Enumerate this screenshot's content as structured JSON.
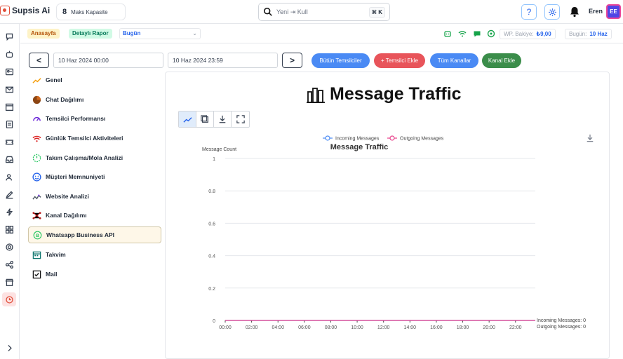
{
  "app": {
    "name": "Supsis Ai"
  },
  "capacity": {
    "value": "8",
    "label": "Maks Kapasite"
  },
  "search": {
    "value": "Yeni ⇥ Kull",
    "shortcut": "⌘ K"
  },
  "user": {
    "name": "Eren",
    "initials": "EE"
  },
  "subbar": {
    "crumb_home": "Anasayfa",
    "crumb_report": "Detaylı Rapor",
    "date_range": "Bugün",
    "wp_balance_label": "WP. Bakiye:",
    "wp_balance_value": "₺9,00",
    "today_label": "Bugün:",
    "today_value": "10 Haz"
  },
  "range": {
    "start": "10 Haz 2024 00:00",
    "end": "10 Haz 2024 23:59",
    "prev": "<",
    "next": ">"
  },
  "filters": [
    {
      "label": "Bütün Temsilciler",
      "color": "#4a8af4"
    },
    {
      "label": "+ Temsilci Ekle",
      "color": "#e8545a"
    },
    {
      "label": "Tüm Kanallar",
      "color": "#4a8af4"
    },
    {
      "label": "Kanal Ekle",
      "color": "#3b8d4a"
    }
  ],
  "menu": [
    {
      "label": "Genel",
      "icon": "trend-icon"
    },
    {
      "label": "Chat Dağılımı",
      "icon": "pie-icon"
    },
    {
      "label": "Temsilci Performansı",
      "icon": "gauge-icon"
    },
    {
      "label": "Günlük Temsilci Aktiviteleri",
      "icon": "wifi-icon"
    },
    {
      "label": "Takım Çalışma/Mola Analizi",
      "icon": "timer-icon"
    },
    {
      "label": "Müşteri Memnuniyeti",
      "icon": "smile-icon"
    },
    {
      "label": "Website Analizi",
      "icon": "analytics-icon"
    },
    {
      "label": "Kanal Dağılımı",
      "icon": "network-icon"
    },
    {
      "label": "Whatsapp Business API",
      "icon": "whatsapp-business-icon"
    },
    {
      "label": "Takvim",
      "icon": "calendar-icon"
    },
    {
      "label": "Mail",
      "icon": "mail-check-icon"
    }
  ],
  "panel": {
    "title": "Message Traffic"
  },
  "chart_data": {
    "type": "line",
    "title": "Message Traffic",
    "ylabel": "Message Count",
    "xlabel": "",
    "ylim": [
      0,
      1
    ],
    "yticks": [
      "0",
      "0.2",
      "0.4",
      "0.6",
      "0.8",
      "1"
    ],
    "categories": [
      "00:00",
      "02:00",
      "04:00",
      "06:00",
      "08:00",
      "10:00",
      "12:00",
      "14:00",
      "16:00",
      "18:00",
      "20:00",
      "22:00"
    ],
    "series": [
      {
        "name": "Incoming Messages",
        "color": "#4a8af4",
        "values": [
          0,
          0,
          0,
          0,
          0,
          0,
          0,
          0,
          0,
          0,
          0,
          0
        ],
        "end_label": "Incoming Messages: 0"
      },
      {
        "name": "Outgoing Messages",
        "color": "#e8408a",
        "values": [
          0,
          0,
          0,
          0,
          0,
          0,
          0,
          0,
          0,
          0,
          0,
          0
        ],
        "end_label": "Outgoing Messages: 0"
      }
    ],
    "legend": "top-center",
    "grid": true
  }
}
